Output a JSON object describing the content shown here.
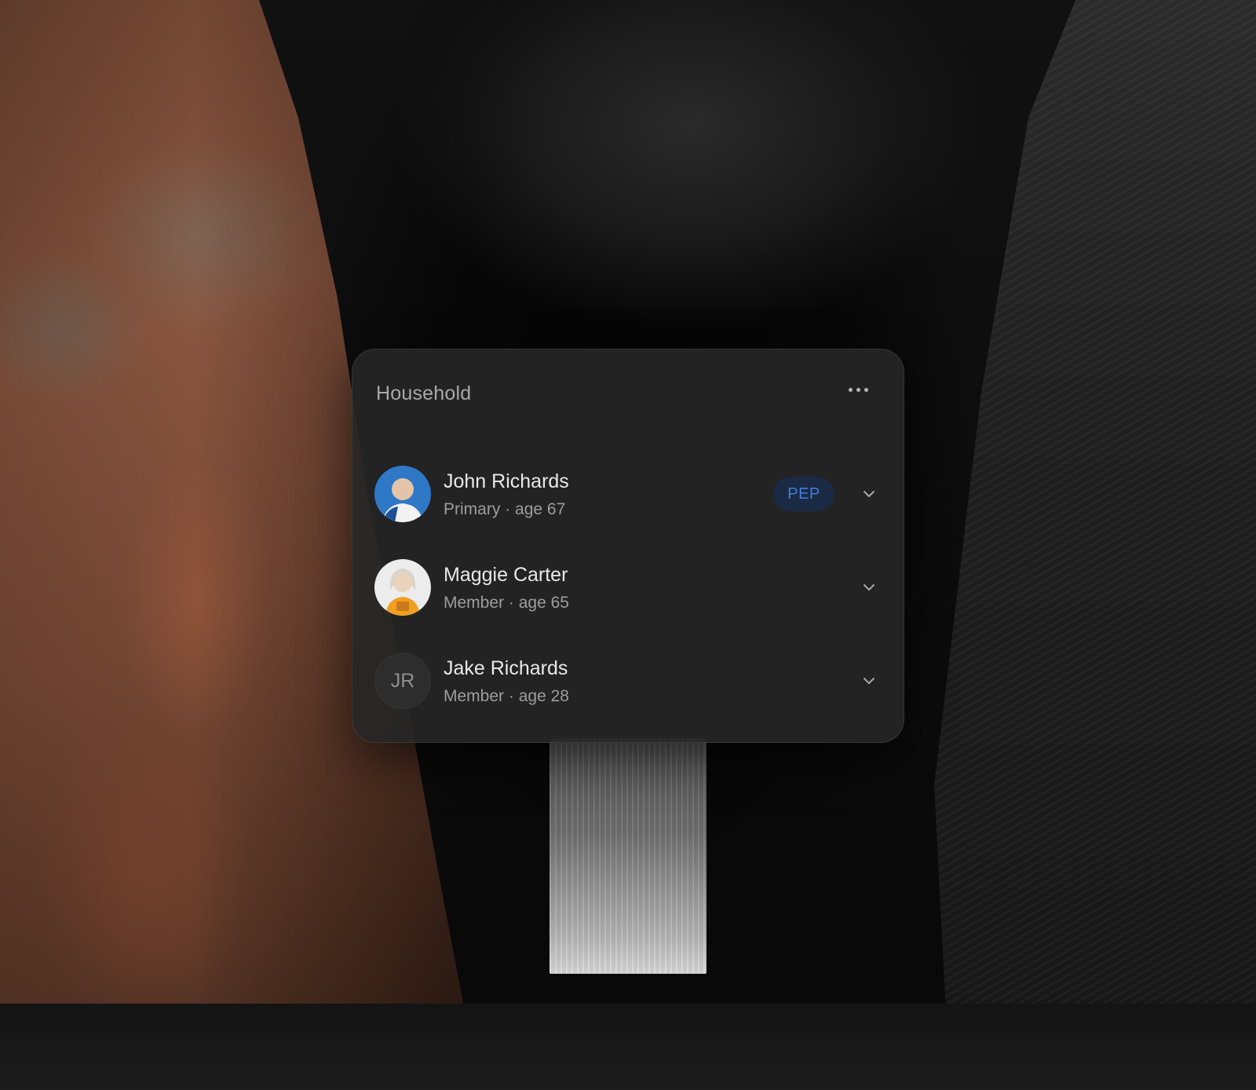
{
  "household": {
    "title": "Household",
    "more_icon": "more-horizontal-icon",
    "members": [
      {
        "name": "John Richards",
        "role": "Primary",
        "age_text": "age 67",
        "separator": "·",
        "badge": "PEP",
        "avatar": "photo",
        "expand_icon": "chevron-down-icon"
      },
      {
        "name": "Maggie Carter",
        "role": "Member",
        "age_text": "age 65",
        "separator": "·",
        "avatar": "photo",
        "expand_icon": "chevron-down-icon"
      },
      {
        "name": "Jake Richards",
        "role": "Member",
        "age_text": "age 28",
        "separator": "·",
        "initials": "JR",
        "expand_icon": "chevron-down-icon"
      }
    ]
  },
  "colors": {
    "card_bg": "#262626",
    "badge_bg": "#1b2a44",
    "badge_text": "#3f7fe0",
    "name_text": "#e9e9e9",
    "meta_text": "#9d9d9d"
  }
}
